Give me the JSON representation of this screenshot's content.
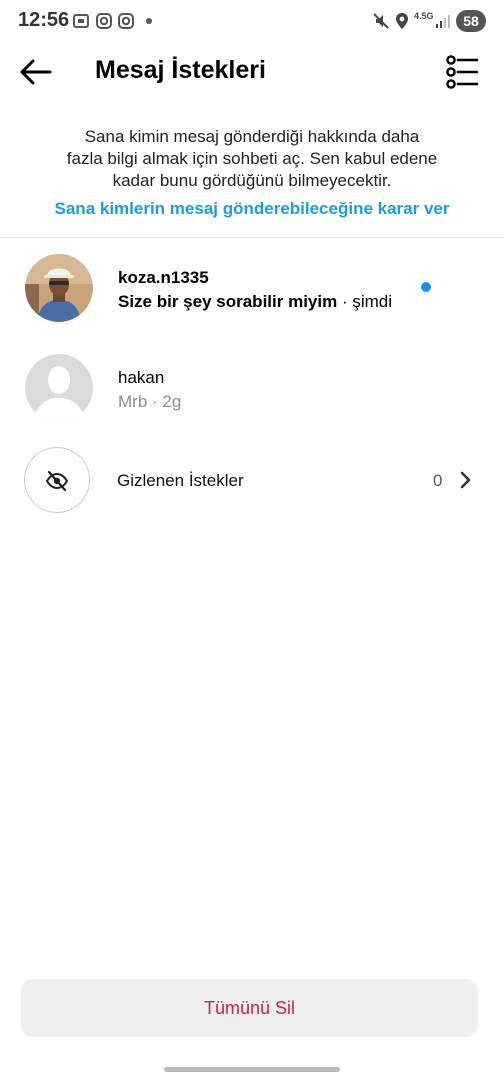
{
  "status_bar": {
    "time": "12:56",
    "network": "4.5G",
    "battery": "58"
  },
  "header": {
    "title": "Mesaj İstekleri",
    "back_icon": "arrow-left-icon",
    "filter_icon": "list-filter-icon"
  },
  "info": {
    "line1": "Sana kimin mesaj gönderdiği hakkında daha",
    "line2": "fazla bilgi almak için sohbeti aç. Sen kabul edene",
    "line3": "kadar bunu gördüğünü bilmeyecektir.",
    "link": "Sana kimlerin mesaj gönderebileceğine karar ver"
  },
  "requests": [
    {
      "name": "koza.n1335",
      "message": "Size bir şey sorabilir miyim",
      "time": "· şimdi",
      "unread": true
    },
    {
      "name": "hakan",
      "message": "Mrb",
      "time": "· 2g",
      "unread": false
    }
  ],
  "hidden": {
    "label": "Gizlenen İstekler",
    "count": "0",
    "icon": "eye-off-icon"
  },
  "footer": {
    "delete_all": "Tümünü Sil"
  },
  "colors": {
    "accent_blue": "#1a9bf0",
    "unread_dot": "#1a8cff",
    "destructive": "#d1223d",
    "button_bg": "#efefef"
  }
}
